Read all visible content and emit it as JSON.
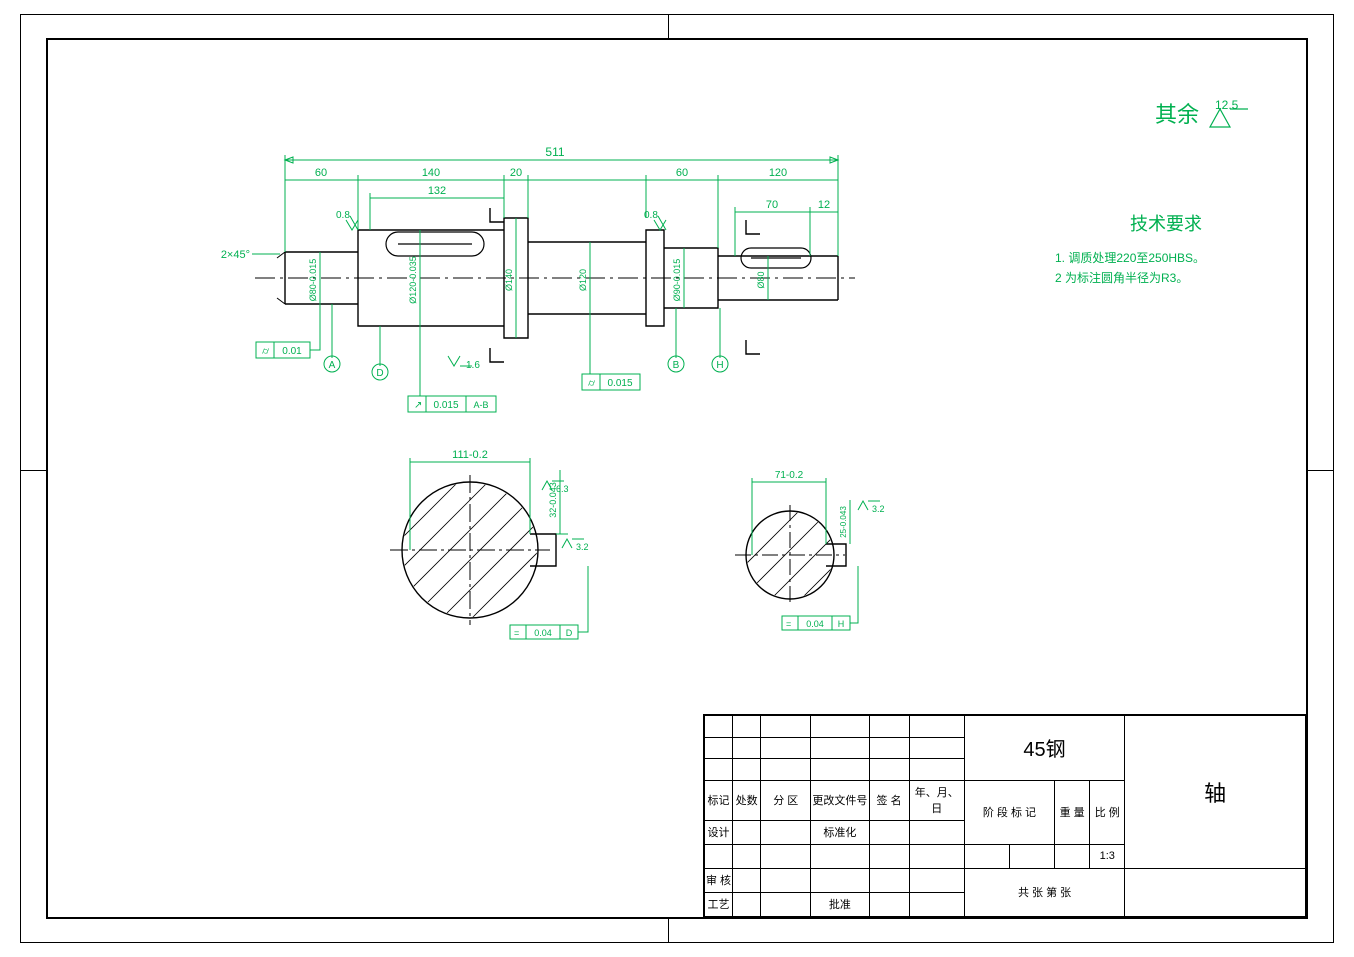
{
  "surface_note": {
    "prefix": "其余",
    "roughness": "12.5"
  },
  "tech": {
    "title": "技术要求",
    "line1": "1. 调质处理220至250HBS。",
    "line2": "2 为标注圆角半径为R3。"
  },
  "dims": {
    "overall": "511",
    "len60a": "60",
    "len140": "140",
    "len20": "20",
    "len60b": "60",
    "len120": "120",
    "len132": "132",
    "len70": "70",
    "len12": "12",
    "chamfer": "2×45°",
    "ra08a": "0.8",
    "ra08b": "0.8",
    "ra16": "1.6"
  },
  "dia": {
    "d1": "Ø80-0.015",
    "d2": "Ø120-0.035",
    "d3": "Ø140",
    "d4": "Ø120",
    "d5": "Ø90-0.015",
    "d6": "Ø80"
  },
  "gtol": {
    "t1": "0.01",
    "t2": "0.015",
    "t3": "0.015",
    "t3ref": "A-B",
    "t4": "0.04",
    "t4ref": "D",
    "t5": "0.04",
    "t5ref": "H"
  },
  "datum": {
    "A": "A",
    "B": "B",
    "D": "D",
    "H": "H"
  },
  "section1": {
    "width": "111-0.2",
    "depth": "32-0.043",
    "ra1": "6.3",
    "ra2": "3.2"
  },
  "section2": {
    "width": "71-0.2",
    "depth": "25-0.043",
    "ra": "3.2"
  },
  "title_block": {
    "material": "45钢",
    "part_name": "轴",
    "hdr": {
      "mark": "标记",
      "count": "处数",
      "zone": "分 区",
      "change": "更改文件号",
      "sign": "签 名",
      "date": "年、月、日"
    },
    "rows": {
      "design": "设计",
      "std": "标准化",
      "check": "审 核",
      "craft": "工艺",
      "approve": "批准"
    },
    "right": {
      "stage": "阶 段 标 记",
      "weight": "重 量",
      "scale": "比 例",
      "scale_val": "1:3",
      "sheet": "共    张  第    张"
    }
  }
}
